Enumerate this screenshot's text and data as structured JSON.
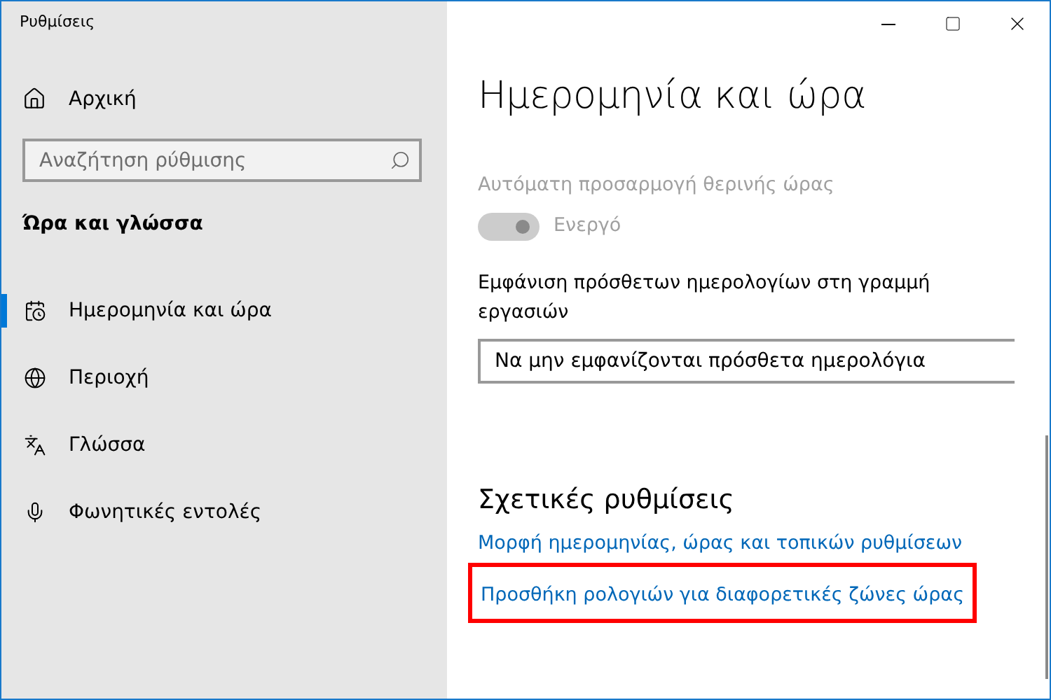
{
  "window": {
    "title": "Ρυθμίσεις"
  },
  "sidebar": {
    "home": "Αρχική",
    "search": {
      "placeholder": "Αναζήτηση ρύθμισης"
    },
    "section": "Ώρα και γλώσσα",
    "items": [
      {
        "label": "Ημερομηνία και ώρα",
        "kind": "calendar",
        "selected": true
      },
      {
        "label": "Περιοχή",
        "kind": "globe",
        "selected": false
      },
      {
        "label": "Γλώσσα",
        "kind": "language",
        "selected": false
      },
      {
        "label": "Φωνητικές εντολές",
        "kind": "mic",
        "selected": false
      }
    ]
  },
  "content": {
    "title": "Ημερομηνία και ώρα",
    "dst": {
      "label": "Αυτόματη προσαρμογή θερινής ώρας",
      "state": "Ενεργό",
      "on": true,
      "disabled": true
    },
    "calendars": {
      "label": "Εμφάνιση πρόσθετων ημερολογίων στη γραμμή εργασιών",
      "value": "Να μην εμφανίζονται πρόσθετα ημερολόγια"
    },
    "related": {
      "heading": "Σχετικές ρυθμίσεις",
      "links": [
        {
          "label": "Μορφή ημερομηνίας, ώρας και τοπικών ρυθμίσεων",
          "highlighted": false
        },
        {
          "label": "Προσθήκη ρολογιών για διαφορετικές ζώνες ώρας",
          "highlighted": true
        }
      ]
    }
  }
}
